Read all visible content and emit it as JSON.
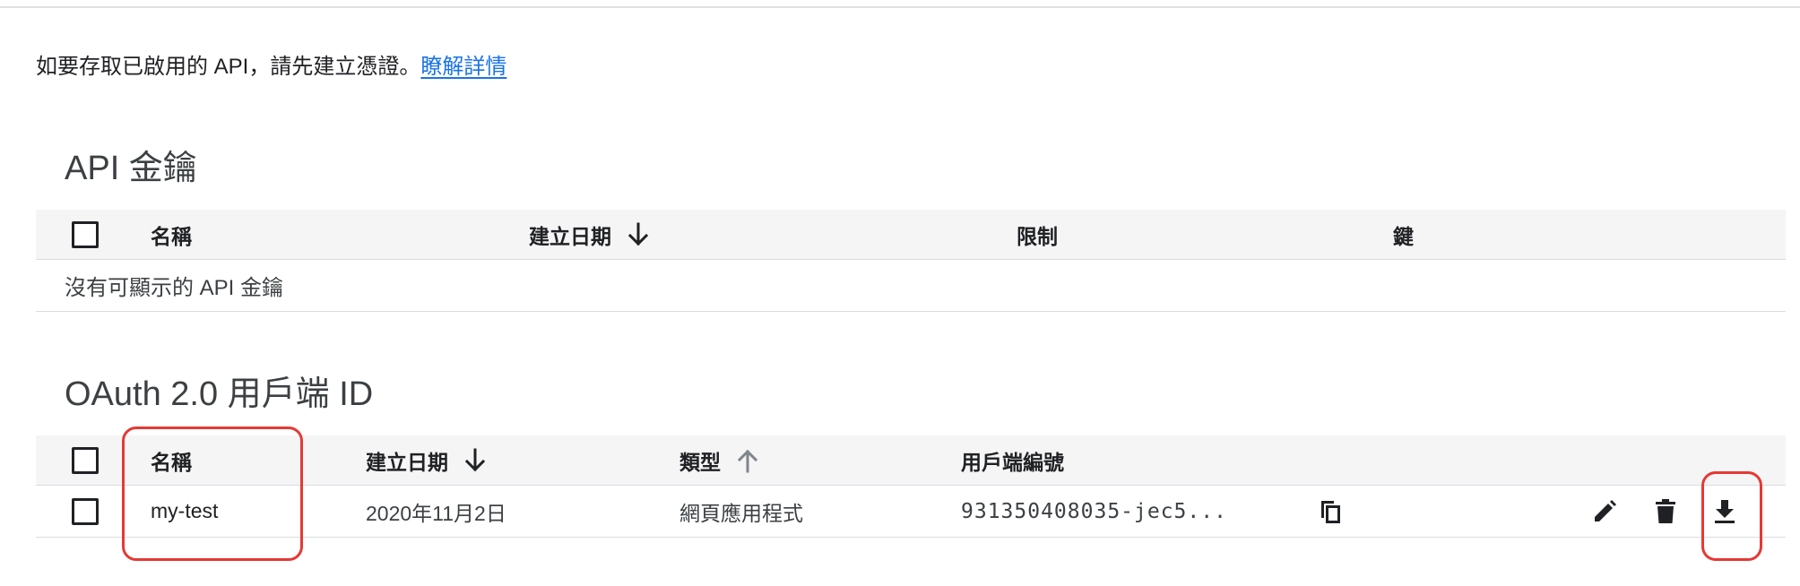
{
  "intro": {
    "text": "如要存取已啟用的 API，請先建立憑證。",
    "link": "瞭解詳情"
  },
  "api_keys": {
    "title": "API 金鑰",
    "columns": {
      "name": "名稱",
      "created": "建立日期",
      "restrictions": "限制",
      "key": "鍵"
    },
    "empty_message": "沒有可顯示的 API 金鑰"
  },
  "oauth": {
    "title": "OAuth 2.0 用戶端 ID",
    "columns": {
      "name": "名稱",
      "created": "建立日期",
      "type": "類型",
      "client_id": "用戶端編號"
    },
    "rows": [
      {
        "name": "my-test",
        "created": "2020年11月2日",
        "type": "網頁應用程式",
        "client_id": "931350408035-jec5..."
      }
    ]
  },
  "colors": {
    "link": "#1a73e8",
    "highlight": "#e53935",
    "header_bg": "#f5f5f5"
  }
}
